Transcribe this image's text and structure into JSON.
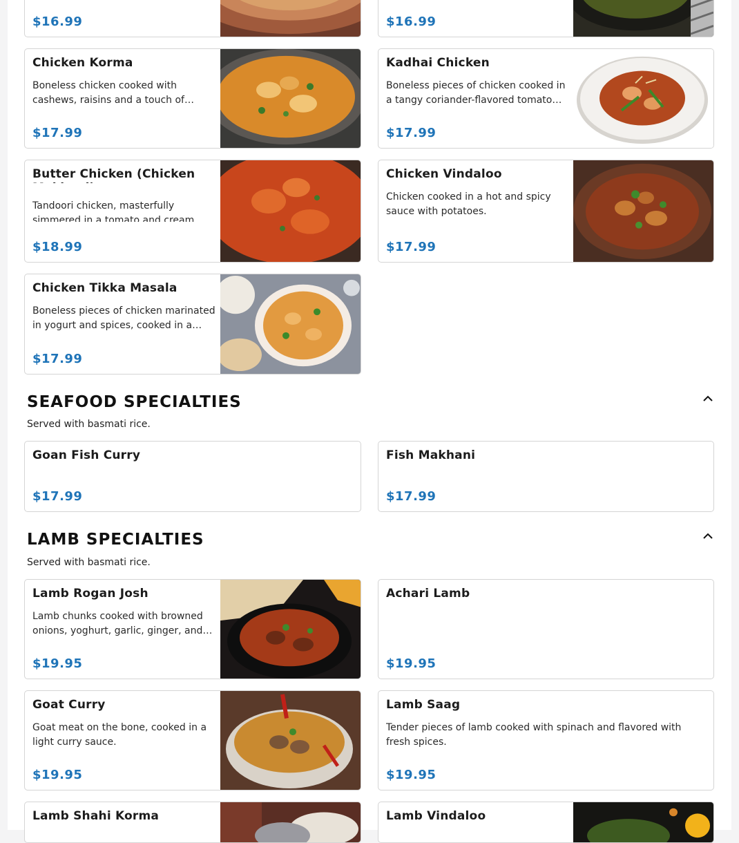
{
  "sections": {
    "chicken": {
      "items": [
        {
          "price": "$16.99"
        },
        {
          "price": "$16.99"
        },
        {
          "name": "Chicken Korma",
          "desc": "Boneless chicken cooked with cashews, raisins and a touch of cream.",
          "price": "$17.99"
        },
        {
          "name": "Kadhai Chicken",
          "desc": "Boneless pieces of chicken cooked in a tangy coriander-flavored tomato sauce.",
          "price": "$17.99"
        },
        {
          "name": "Butter Chicken (Chicken Makhani)",
          "desc": "Tandoori chicken, masterfully simmered in a tomato and cream sauce.",
          "price": "$18.99"
        },
        {
          "name": "Chicken Vindaloo",
          "desc": "Chicken cooked in a hot and spicy sauce with potatoes.",
          "price": "$17.99"
        },
        {
          "name": "Chicken Tikka Masala",
          "desc": "Boneless pieces of chicken marinated in yogurt and spices, cooked in a creamy sauce.",
          "price": "$17.99"
        }
      ]
    },
    "seafood": {
      "title": "SEAFOOD SPECIALTIES",
      "subtitle": "Served with basmati rice.",
      "items": [
        {
          "name": "Goan Fish Curry",
          "price": "$17.99"
        },
        {
          "name": "Fish Makhani",
          "price": "$17.99"
        }
      ]
    },
    "lamb": {
      "title": "LAMB SPECIALTIES",
      "subtitle": "Served with basmati rice.",
      "items": [
        {
          "name": "Lamb Rogan Josh",
          "desc": "Lamb chunks cooked with browned onions, yoghurt, garlic, ginger, and aromatic spices.",
          "price": "$19.95"
        },
        {
          "name": "Achari Lamb",
          "price": "$19.95"
        },
        {
          "name": "Goat Curry",
          "desc": "Goat meat on the bone, cooked in a light curry sauce.",
          "price": "$19.95"
        },
        {
          "name": "Lamb Saag",
          "desc": "Tender pieces of lamb cooked with spinach and flavored with fresh spices.",
          "price": "$19.95"
        },
        {
          "name": "Lamb Shahi Korma"
        },
        {
          "name": "Lamb Vindaloo"
        }
      ]
    }
  },
  "colors": {
    "price": "#1f74b8",
    "border": "#d4d4d4"
  },
  "icons": {
    "collapse": "chevron-up-icon"
  }
}
